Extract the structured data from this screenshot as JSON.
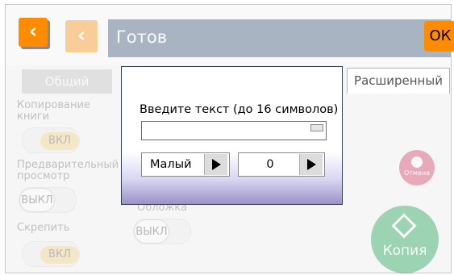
{
  "header": {
    "title": "Готов",
    "back_icon": "chevron-left-icon",
    "ok_label": "ОК",
    "brand_color": "#ff8c00"
  },
  "tabs": [
    {
      "label": "Общий"
    },
    {
      "label": "Расширенный"
    }
  ],
  "settings": [
    {
      "label": "Копирование книги",
      "value": "ВКЛ"
    },
    {
      "label": "Предварительный просмотр",
      "value": "ВЫКЛ"
    },
    {
      "label": "Скрепить",
      "value": "ВКЛ"
    },
    {
      "label": "Обложка",
      "value": "ВЫКЛ"
    }
  ],
  "actions": {
    "cancel_label": "Отмена",
    "copy_label": "Копия"
  },
  "dialog": {
    "title": "Введите текст (до 16 символов)",
    "text_value": "",
    "size_value": "Малый",
    "number_value": "0"
  }
}
